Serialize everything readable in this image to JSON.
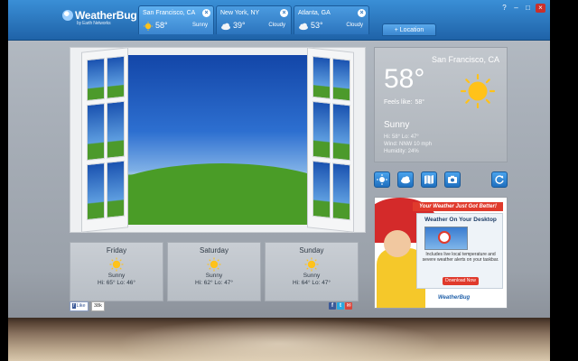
{
  "app": {
    "logo_text": "WeatherBug",
    "logo_sub": "by Earth Networks",
    "brand_color": "#2c74bd"
  },
  "tabs": [
    {
      "city": "San Francisco, CA",
      "temp": "58°",
      "condition": "Sunny",
      "icon": "sun-icon",
      "active": true
    },
    {
      "city": "New York, NY",
      "temp": "39°",
      "condition": "Cloudy",
      "icon": "cloud-icon",
      "active": false
    },
    {
      "city": "Atlanta, GA",
      "temp": "53°",
      "condition": "Cloudy",
      "icon": "cloud-icon",
      "active": false
    }
  ],
  "add_location_label": "+ Location",
  "window_controls": {
    "help": "?",
    "minimize": "–",
    "maximize": "□",
    "close": "×"
  },
  "forecast": [
    {
      "day": "Friday",
      "condition": "Sunny",
      "hilo": "Hi: 65° Lo: 46°"
    },
    {
      "day": "Saturday",
      "condition": "Sunny",
      "hilo": "Hi: 62° Lo: 47°"
    },
    {
      "day": "Sunday",
      "condition": "Sunny",
      "hilo": "Hi: 64° Lo: 47°"
    }
  ],
  "social": {
    "like_label": "Like",
    "like_count": "38k"
  },
  "current": {
    "city": "San Francisco, CA",
    "temp": "58°",
    "feels_label": "Feels like:",
    "feels_value": "58°",
    "condition": "Sunny",
    "hilo": "Hi: 58° Lo: 47°",
    "wind": "Wind: NNW 10 mph",
    "humidity": "Humidity: 24%"
  },
  "ad": {
    "headline": "Your Weather Just Got Better!",
    "title": "Weather On Your Desktop",
    "text": "Includes live local temperature and severe weather alerts on your taskbar.",
    "download": "Download Now",
    "brand": "WeatherBug"
  }
}
